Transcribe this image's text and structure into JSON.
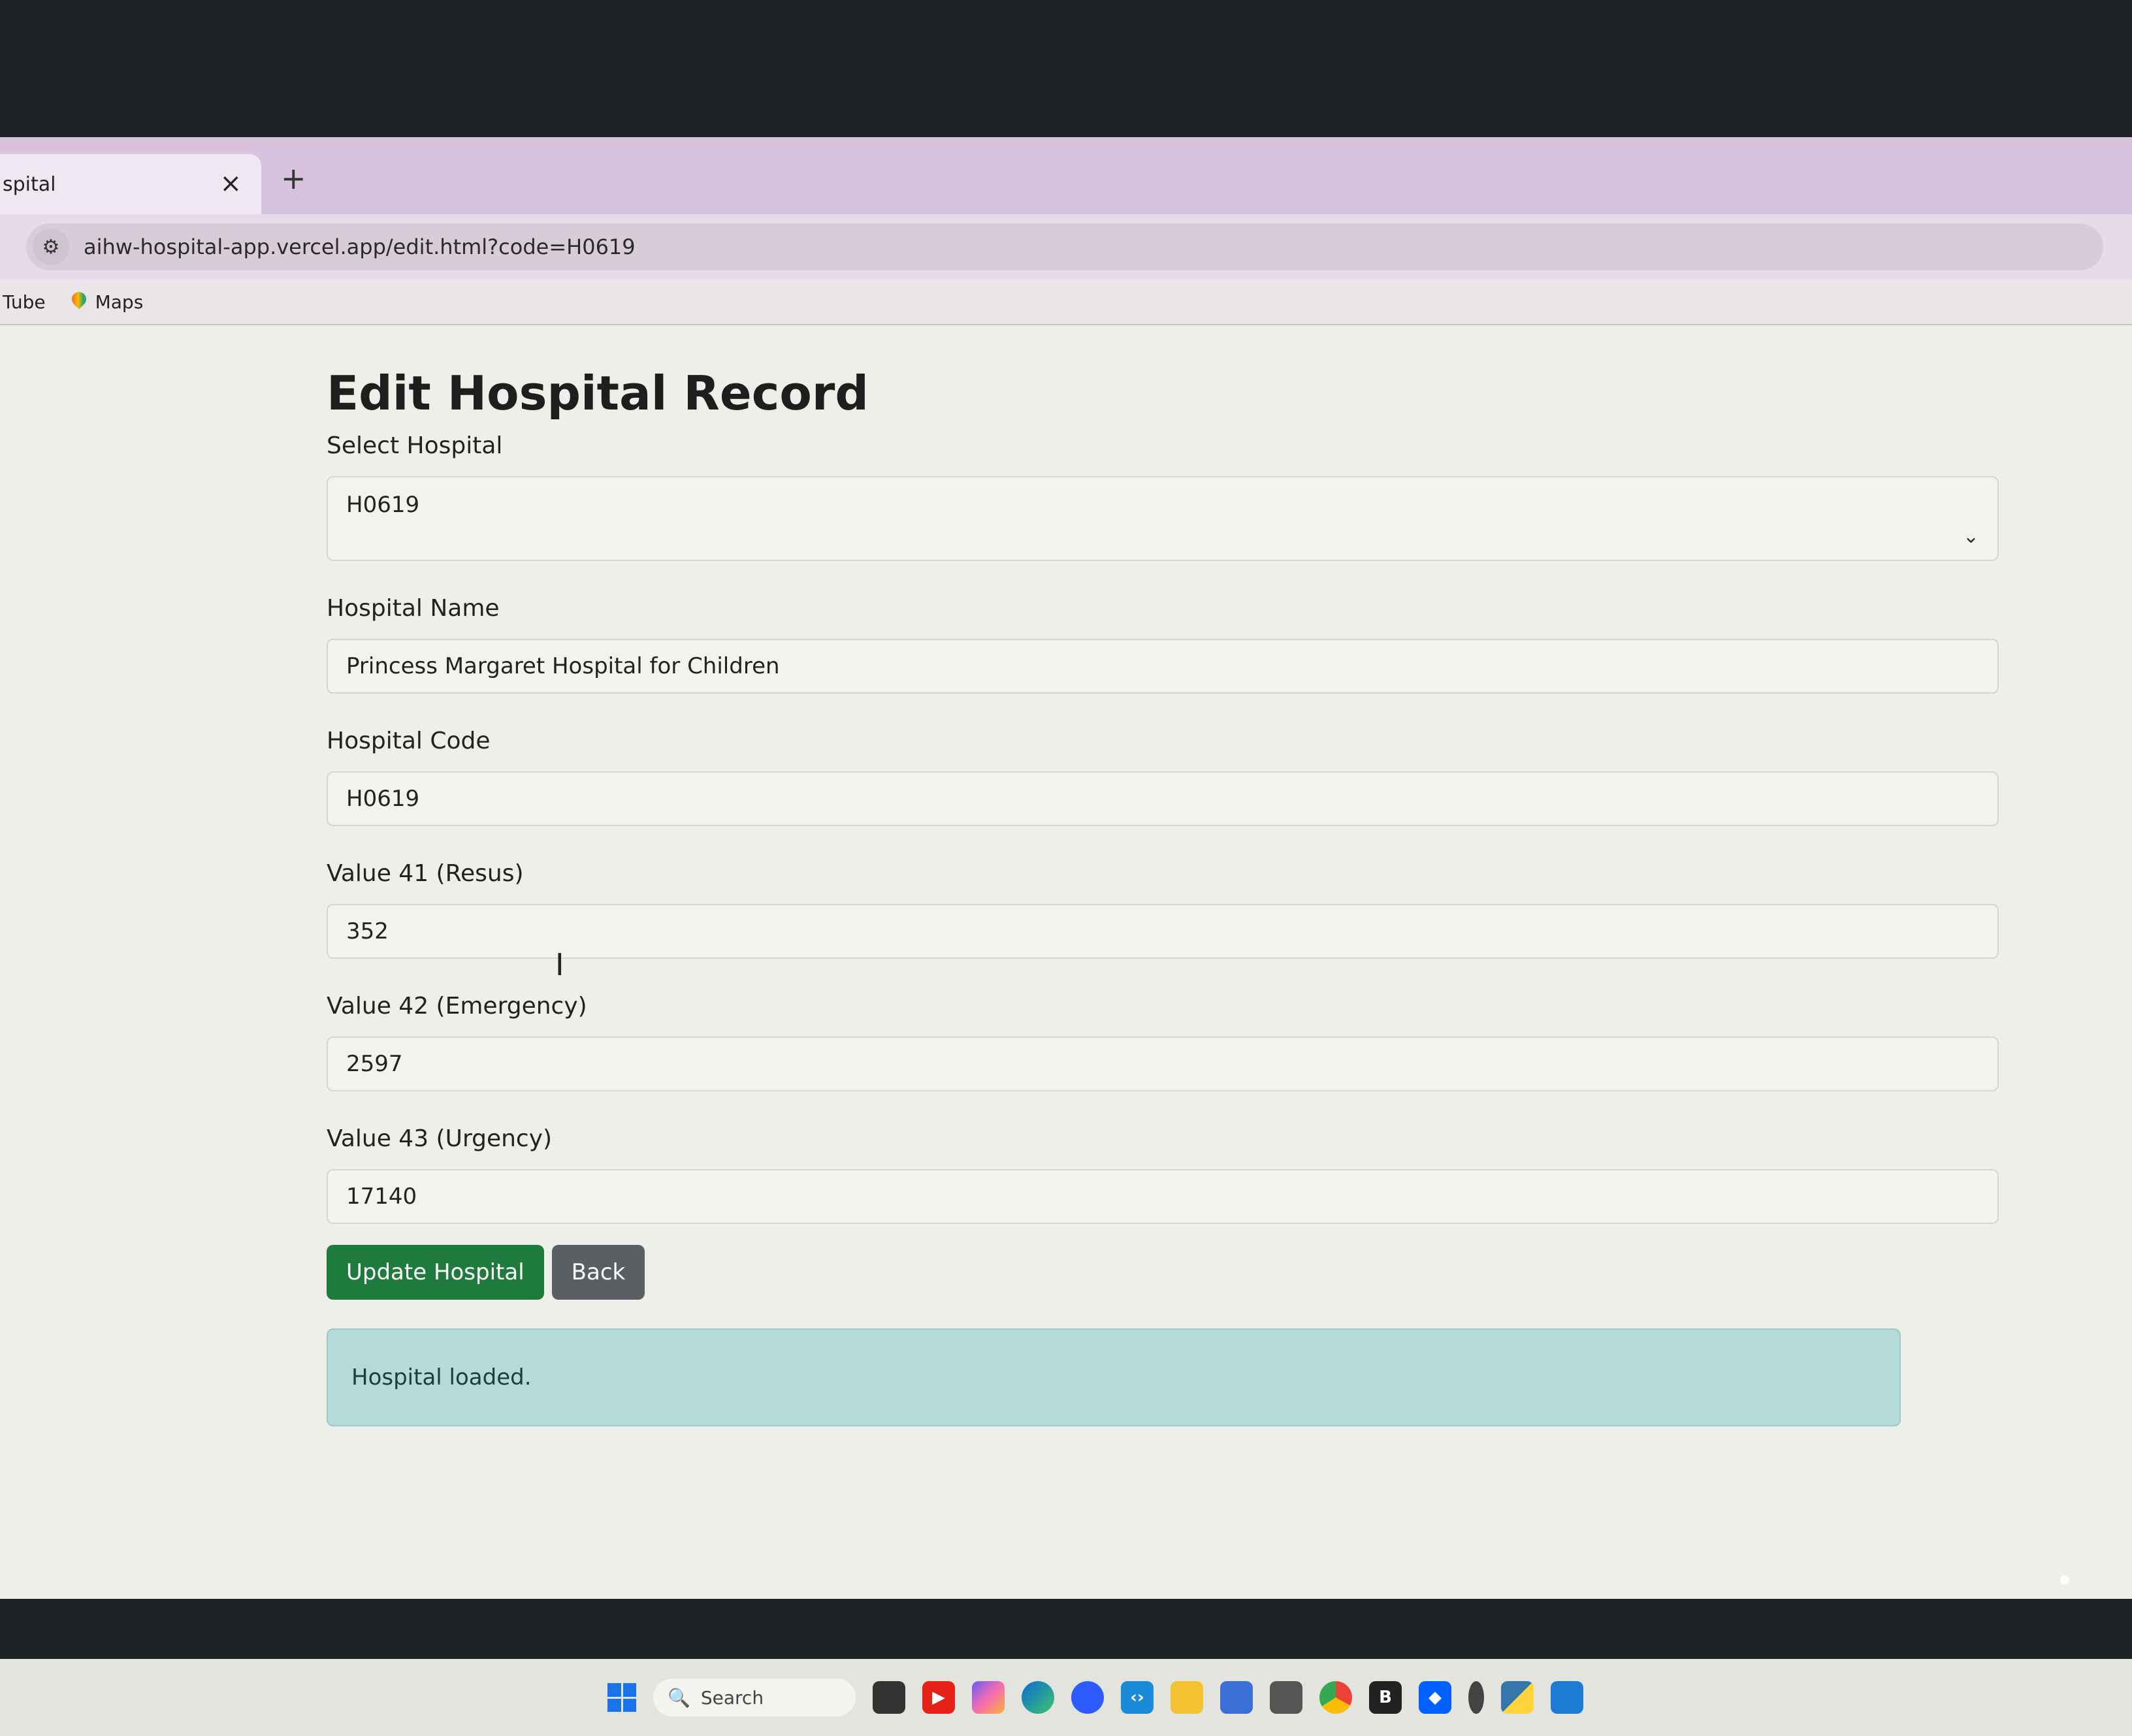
{
  "browser": {
    "tab_title": "spital",
    "tab_close": "×",
    "new_tab": "+",
    "url": "aihw-hospital-app.vercel.app/edit.html?code=H0619",
    "bookmarks": [
      {
        "label": "Tube"
      },
      {
        "label": "Maps"
      }
    ]
  },
  "form": {
    "title": "Edit Hospital Record",
    "select_label": "Select Hospital",
    "select_value": "H0619",
    "name_label": "Hospital Name",
    "name_value": "Princess Margaret Hospital for Children",
    "code_label": "Hospital Code",
    "code_value": "H0619",
    "v41_label": "Value 41 (Resus)",
    "v41_value": "352",
    "v42_label": "Value 42 (Emergency)",
    "v42_value": "2597",
    "v43_label": "Value 43 (Urgency)",
    "v43_value": "17140",
    "update_label": "Update Hospital",
    "back_label": "Back",
    "status_message": "Hospital loaded."
  },
  "taskbar": {
    "search_placeholder": "Search",
    "icons": [
      "start-icon",
      "youtube-icon",
      "copilot-icon",
      "edge-icon",
      "zoom-icon",
      "vscode-icon",
      "file-explorer-icon",
      "store-icon",
      "chrome-icon",
      "b-icon",
      "dropbox-icon",
      "python-icon"
    ]
  },
  "colors": {
    "update_button": "#1f7a3e",
    "back_button": "#5a5f63",
    "alert_bg": "#b4dbd9"
  }
}
